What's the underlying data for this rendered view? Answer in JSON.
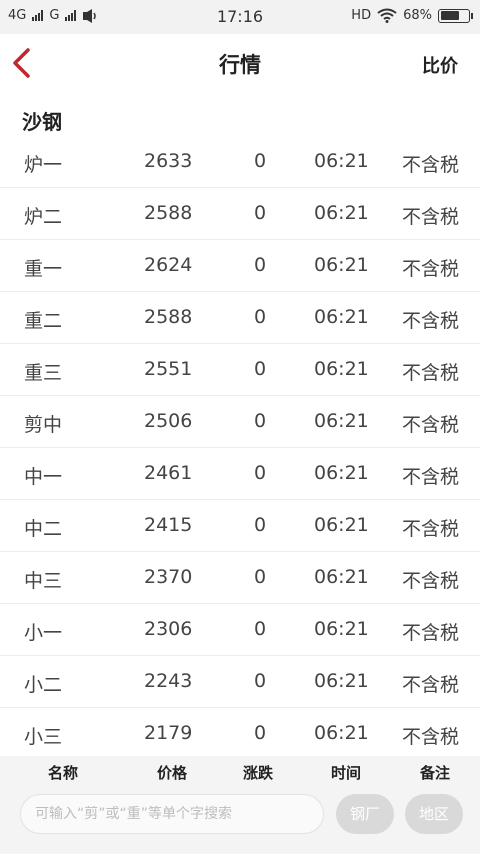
{
  "status_bar": {
    "network1": "4G",
    "network2": "G",
    "time": "17:16",
    "hd": "HD",
    "battery": "68%",
    "battery_level": 0.68
  },
  "header": {
    "title": "行情",
    "compare": "比价"
  },
  "section": {
    "title": "沙钢"
  },
  "rows": [
    {
      "name": "炉一",
      "price": "2633",
      "change": "0",
      "time": "06:21",
      "note": "不含税"
    },
    {
      "name": "炉二",
      "price": "2588",
      "change": "0",
      "time": "06:21",
      "note": "不含税"
    },
    {
      "name": "重一",
      "price": "2624",
      "change": "0",
      "time": "06:21",
      "note": "不含税"
    },
    {
      "name": "重二",
      "price": "2588",
      "change": "0",
      "time": "06:21",
      "note": "不含税"
    },
    {
      "name": "重三",
      "price": "2551",
      "change": "0",
      "time": "06:21",
      "note": "不含税"
    },
    {
      "name": "剪中",
      "price": "2506",
      "change": "0",
      "time": "06:21",
      "note": "不含税"
    },
    {
      "name": "中一",
      "price": "2461",
      "change": "0",
      "time": "06:21",
      "note": "不含税"
    },
    {
      "name": "中二",
      "price": "2415",
      "change": "0",
      "time": "06:21",
      "note": "不含税"
    },
    {
      "name": "中三",
      "price": "2370",
      "change": "0",
      "time": "06:21",
      "note": "不含税"
    },
    {
      "name": "小一",
      "price": "2306",
      "change": "0",
      "time": "06:21",
      "note": "不含税"
    },
    {
      "name": "小二",
      "price": "2243",
      "change": "0",
      "time": "06:21",
      "note": "不含税"
    },
    {
      "name": "小三",
      "price": "2179",
      "change": "0",
      "time": "06:21",
      "note": "不含税"
    }
  ],
  "columns": {
    "name": "名称",
    "price": "价格",
    "change": "涨跌",
    "time": "时间",
    "note": "备注"
  },
  "search": {
    "placeholder": "可输入“剪”或“重”等单个字搜索",
    "value": ""
  },
  "filters": {
    "mill": "钢厂",
    "region": "地区"
  },
  "colors": {
    "accent": "#c0282d",
    "pill": "#d9d9d9"
  }
}
